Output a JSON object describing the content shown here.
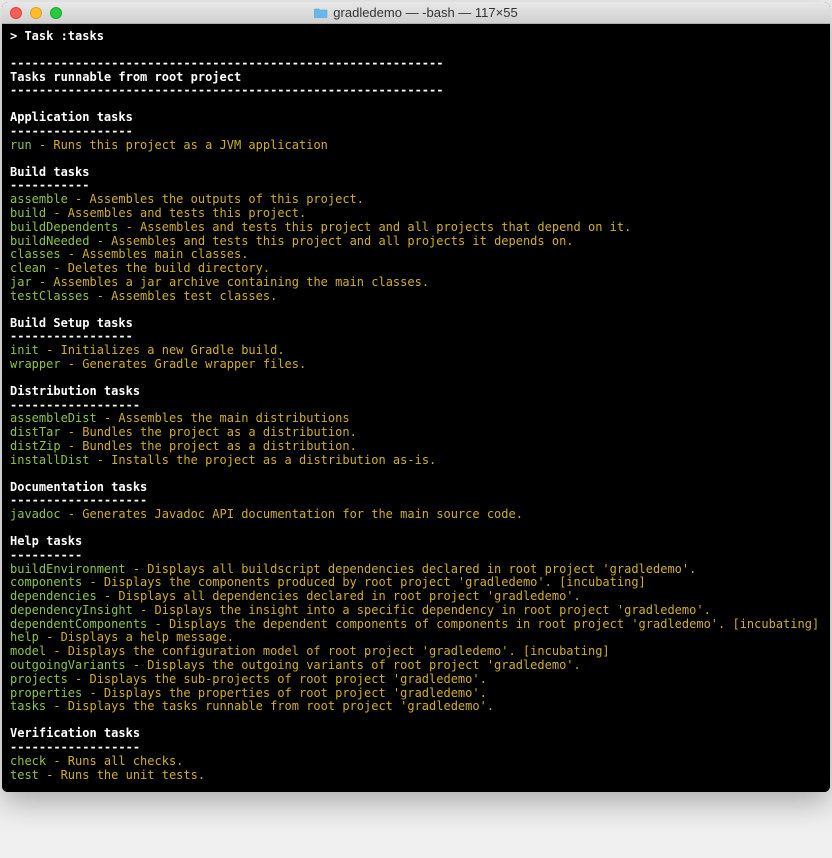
{
  "window": {
    "title": "gradledemo — -bash — 117×55"
  },
  "prompt": "> Task :tasks",
  "main_rule": "------------------------------------------------------------",
  "main_heading": "Tasks runnable from root project",
  "sections": [
    {
      "title": "Application tasks",
      "rule": "-----------------",
      "tasks": [
        {
          "name": "run",
          "desc": " - Runs this project as a JVM application"
        }
      ]
    },
    {
      "title": "Build tasks",
      "rule": "-----------",
      "tasks": [
        {
          "name": "assemble",
          "desc": " - Assembles the outputs of this project."
        },
        {
          "name": "build",
          "desc": " - Assembles and tests this project."
        },
        {
          "name": "buildDependents",
          "desc": " - Assembles and tests this project and all projects that depend on it."
        },
        {
          "name": "buildNeeded",
          "desc": " - Assembles and tests this project and all projects it depends on."
        },
        {
          "name": "classes",
          "desc": " - Assembles main classes."
        },
        {
          "name": "clean",
          "desc": " - Deletes the build directory."
        },
        {
          "name": "jar",
          "desc": " - Assembles a jar archive containing the main classes."
        },
        {
          "name": "testClasses",
          "desc": " - Assembles test classes."
        }
      ]
    },
    {
      "title": "Build Setup tasks",
      "rule": "-----------------",
      "tasks": [
        {
          "name": "init",
          "desc": " - Initializes a new Gradle build."
        },
        {
          "name": "wrapper",
          "desc": " - Generates Gradle wrapper files."
        }
      ]
    },
    {
      "title": "Distribution tasks",
      "rule": "------------------",
      "tasks": [
        {
          "name": "assembleDist",
          "desc": " - Assembles the main distributions"
        },
        {
          "name": "distTar",
          "desc": " - Bundles the project as a distribution."
        },
        {
          "name": "distZip",
          "desc": " - Bundles the project as a distribution."
        },
        {
          "name": "installDist",
          "desc": " - Installs the project as a distribution as-is."
        }
      ]
    },
    {
      "title": "Documentation tasks",
      "rule": "-------------------",
      "tasks": [
        {
          "name": "javadoc",
          "desc": " - Generates Javadoc API documentation for the main source code."
        }
      ]
    },
    {
      "title": "Help tasks",
      "rule": "----------",
      "tasks": [
        {
          "name": "buildEnvironment",
          "desc": " - Displays all buildscript dependencies declared in root project 'gradledemo'."
        },
        {
          "name": "components",
          "desc": " - Displays the components produced by root project 'gradledemo'. [incubating]"
        },
        {
          "name": "dependencies",
          "desc": " - Displays all dependencies declared in root project 'gradledemo'."
        },
        {
          "name": "dependencyInsight",
          "desc": " - Displays the insight into a specific dependency in root project 'gradledemo'."
        },
        {
          "name": "dependentComponents",
          "desc": " - Displays the dependent components of components in root project 'gradledemo'. [incubating]"
        },
        {
          "name": "help",
          "desc": " - Displays a help message."
        },
        {
          "name": "model",
          "desc": " - Displays the configuration model of root project 'gradledemo'. [incubating]"
        },
        {
          "name": "outgoingVariants",
          "desc": " - Displays the outgoing variants of root project 'gradledemo'."
        },
        {
          "name": "projects",
          "desc": " - Displays the sub-projects of root project 'gradledemo'."
        },
        {
          "name": "properties",
          "desc": " - Displays the properties of root project 'gradledemo'."
        },
        {
          "name": "tasks",
          "desc": " - Displays the tasks runnable from root project 'gradledemo'."
        }
      ]
    },
    {
      "title": "Verification tasks",
      "rule": "------------------",
      "tasks": [
        {
          "name": "check",
          "desc": " - Runs all checks."
        },
        {
          "name": "test",
          "desc": " - Runs the unit tests."
        }
      ]
    }
  ]
}
